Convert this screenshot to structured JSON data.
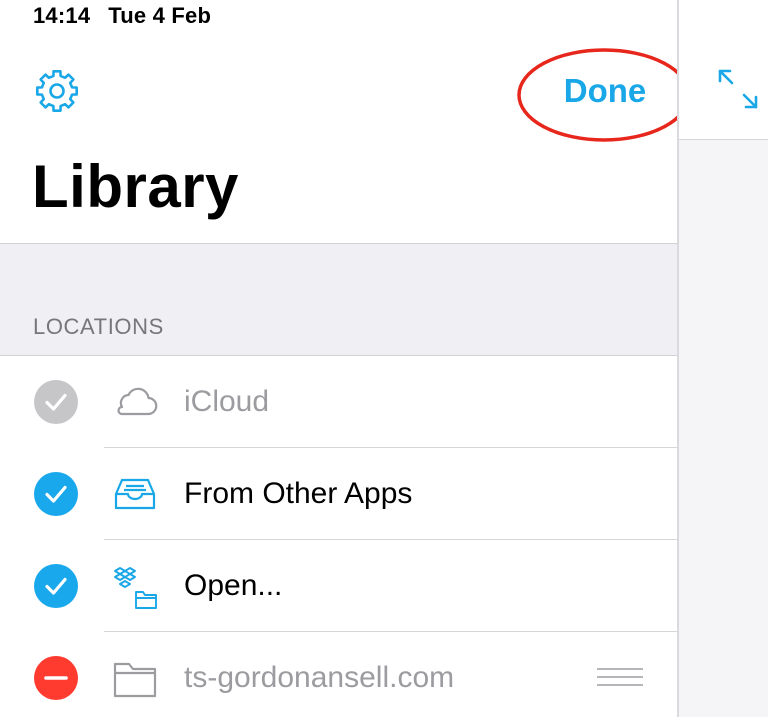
{
  "status_bar": {
    "time": "14:14",
    "date": "Tue 4 Feb"
  },
  "nav": {
    "done_label": "Done",
    "settings_icon": "gear-icon",
    "expand_icon": "expand-arrows-icon"
  },
  "title": "Library",
  "section": {
    "label": "LOCATIONS"
  },
  "locations": [
    {
      "label": "iCloud",
      "icon": "cloud-icon",
      "state": "disabled-check"
    },
    {
      "label": "From Other Apps",
      "icon": "inbox-tray-icon",
      "state": "checked"
    },
    {
      "label": "Open...",
      "icon": "dropbox-folder-icon",
      "state": "checked"
    },
    {
      "label": "ts-gordonansell.com",
      "icon": "folder-icon",
      "state": "delete"
    }
  ],
  "colors": {
    "accent": "#1aa7e8",
    "delete": "#ff3b30",
    "disabled": "#c6c6c8",
    "annotation": "#e8271c"
  }
}
